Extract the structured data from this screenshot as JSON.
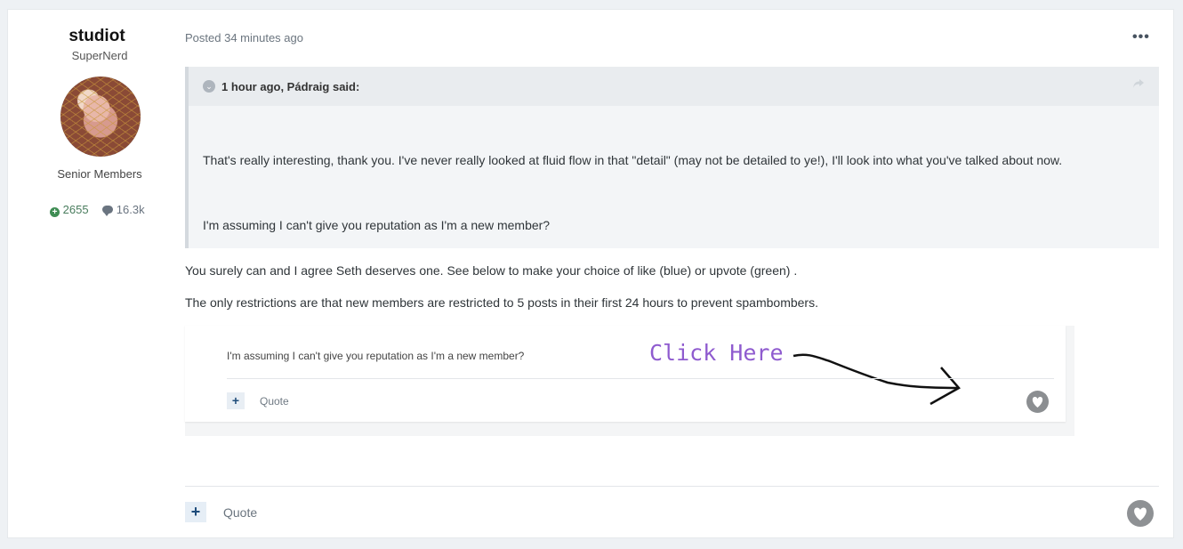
{
  "author": {
    "name": "studiot",
    "title": "SuperNerd",
    "group": "Senior Members",
    "reputation": "2655",
    "posts": "16.3k"
  },
  "post": {
    "posted": "Posted 34 minutes ago",
    "menu_icon": "•••",
    "quote": {
      "citation": "1 hour ago, Pádraig said:",
      "p1": "That's really interesting, thank you. I've never really looked at fluid flow in that \"detail\" (may not be detailed to ye!), I'll look into what you've talked about now.",
      "p2": "I'm assuming I can't give you reputation as I'm a new member?"
    },
    "body_p1": "You surely can and I agree Seth deserves one.  See below to make your choice of like (blue) or upvote (green) .",
    "body_p2": "The only restrictions are that new members are restricted to 5 posts in their first 24 hours to prevent spambombers.",
    "embed": {
      "text": "I'm assuming I can't give you reputation as I'm a new member?",
      "click_here": "Click Here",
      "plus": "+",
      "quote": "Quote"
    },
    "footer": {
      "plus": "+",
      "quote": "Quote"
    }
  },
  "colors": {
    "background": "#eef1f4",
    "reputation_green": "#3f8d54",
    "accent_blue": "#1d4b7a",
    "click_here_purple": "#8f5bcf"
  },
  "icons": [
    "plus-circle-icon",
    "comment-icon",
    "chevron-down-icon",
    "share-icon",
    "ellipsis-icon",
    "heart-icon",
    "plus-icon"
  ]
}
